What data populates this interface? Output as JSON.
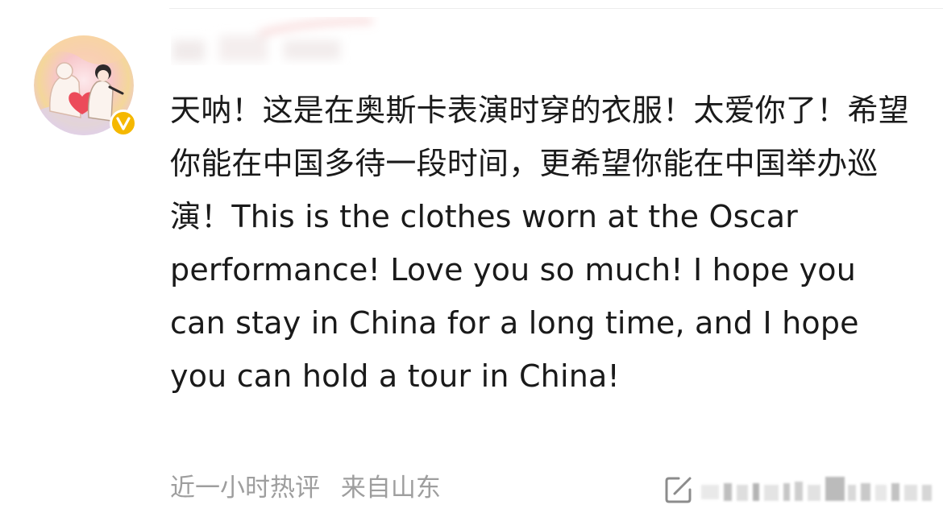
{
  "comment": {
    "text": "天呐！这是在奥斯卡表演时穿的衣服！太爱你了！希望你能在中国多待一段时间，更希望你能在中国举办巡演！This is the clothes worn at the Oscar performance! Love you so much! I hope you can stay in China for a long time, and I hope you can hold a tour in China!",
    "time_label": "近一小时热评",
    "source_label": "来自山东"
  },
  "avatar": {
    "verified_badge_icon": "verified-v-icon",
    "badge_color": "#f5b800"
  },
  "actions": {
    "share_icon": "share-icon"
  },
  "colors": {
    "text": "#1a1a1a",
    "meta": "#9e9e9e"
  }
}
